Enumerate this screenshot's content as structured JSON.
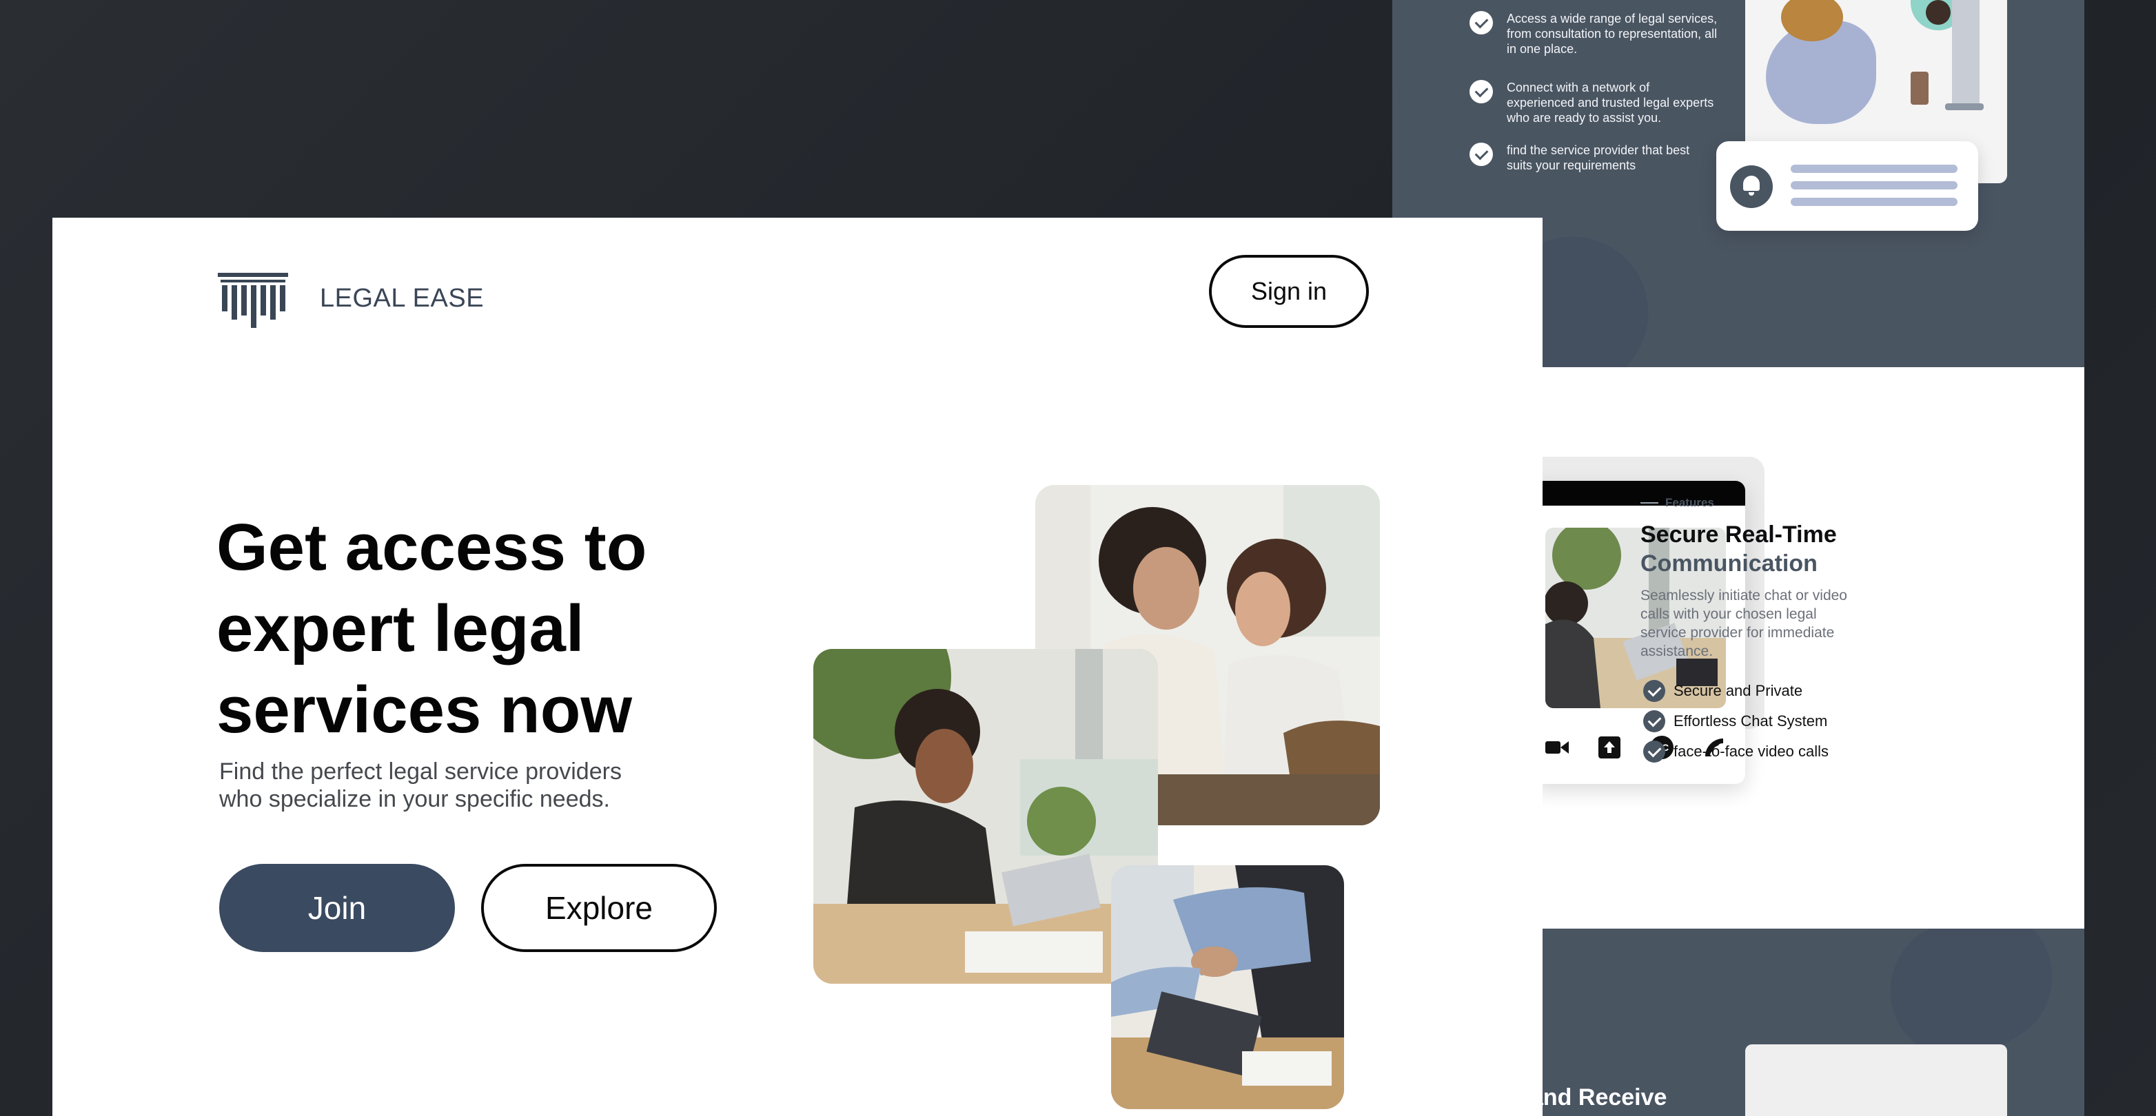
{
  "landing": {
    "brand": "LEGAL EASE",
    "signin_label": "Sign in",
    "headline": [
      "Get access to",
      "expert legal",
      "services now"
    ],
    "subtext": [
      "Find the perfect legal service providers",
      "who specialize in your specific needs."
    ],
    "join_label": "Join",
    "explore_label": "Explore",
    "photos": [
      {
        "icon": "two-women-laughing-photo"
      },
      {
        "icon": "woman-waving-at-laptop-photo"
      },
      {
        "icon": "handshake-over-laptop-photo"
      }
    ]
  },
  "backdrop": {
    "benefits": [
      {
        "text": "Access a wide range of legal services, from consultation to representation, all in one place."
      },
      {
        "text": "Connect with a network of experienced and trusted legal experts who are ready to assist you."
      },
      {
        "text": "find the service provider that best suits your requirements"
      }
    ],
    "features": {
      "tag": "Features",
      "title_line1": "Secure Real-Time",
      "title_line2": "Communication",
      "description": "Seamlessly initiate chat or video calls with your chosen legal service provider for immediate assistance.",
      "items": [
        "Secure and Private",
        "Effortless Chat System",
        "face-to-face video calls"
      ]
    },
    "bottom_title": "and Receive",
    "call_controls": [
      "video-icon",
      "upload-icon",
      "cc-icon",
      "phone-icon"
    ]
  },
  "colors": {
    "slate": "#4a5562",
    "button_dark": "#3a4a60",
    "background_dark": "#24282d"
  }
}
